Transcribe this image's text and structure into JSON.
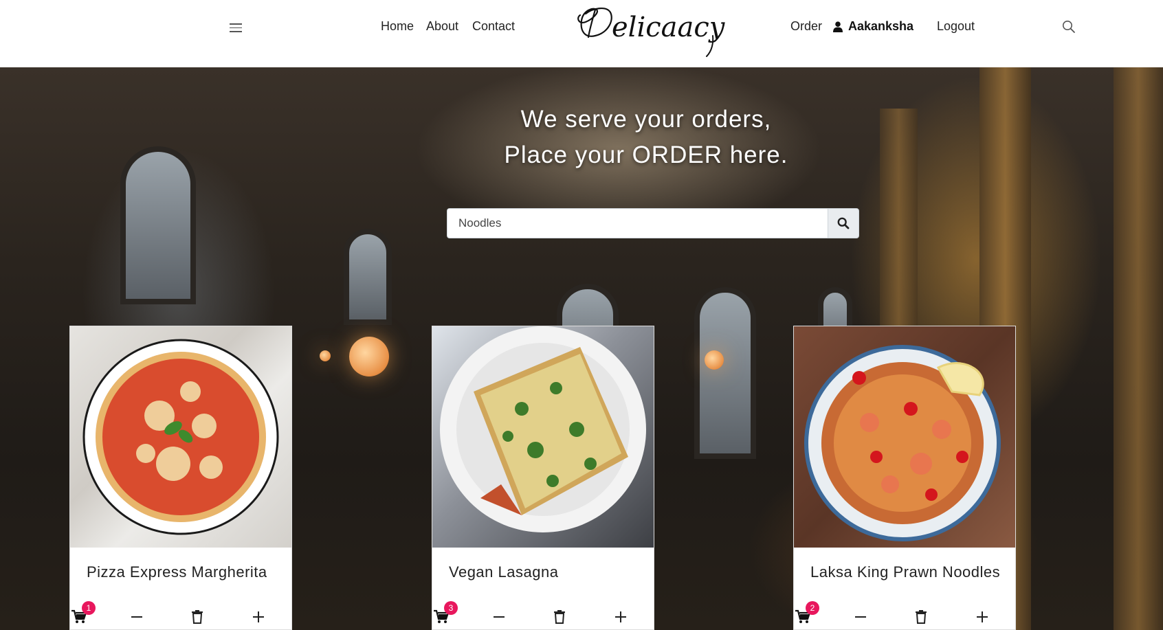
{
  "navbar": {
    "brand": "Delicaacy",
    "links": {
      "home": "Home",
      "about": "About",
      "contact": "Contact",
      "order": "Order",
      "logout": "Logout"
    },
    "user_name": "Aakanksha",
    "icons": {
      "menu": "hamburger-menu-icon",
      "user": "user-icon",
      "search": "search-icon"
    }
  },
  "hero": {
    "title_line1": "We serve your orders,",
    "title_line2": "Place your ORDER here.",
    "search": {
      "value": "Noodles",
      "button_icon": "search-icon"
    }
  },
  "menu_items": [
    {
      "name": "Pizza Express Margherita",
      "cart_count": "1"
    },
    {
      "name": "Vegan Lasagna",
      "cart_count": "3"
    },
    {
      "name": "Laksa King Prawn Noodles",
      "cart_count": "2"
    }
  ],
  "card_actions": {
    "icons": [
      "cart-icon",
      "minus-icon",
      "trash-icon",
      "plus-icon"
    ]
  },
  "colors": {
    "badge": "#e8175d",
    "navbar_bg": "#ffffff",
    "search_button_bg": "#e9ecef"
  }
}
